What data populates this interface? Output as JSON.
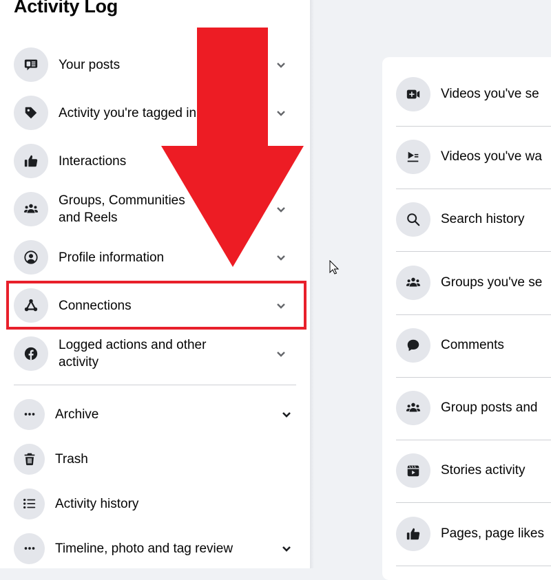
{
  "sidebar": {
    "title": "Activity Log",
    "items": [
      {
        "label": "Your posts",
        "icon": "post-icon",
        "expandable": true
      },
      {
        "label": "Activity you're tagged in",
        "icon": "tag-icon",
        "expandable": true
      },
      {
        "label": "Interactions",
        "icon": "thumbs-up-icon",
        "expandable": false
      },
      {
        "label": "Groups, Communities and Reels",
        "label_line1": "Groups, Communities",
        "label_line2": "and Reels",
        "icon": "groups-icon",
        "expandable": true
      },
      {
        "label": "Profile information",
        "icon": "profile-icon",
        "expandable": true
      },
      {
        "label": "Connections",
        "icon": "connections-icon",
        "expandable": true,
        "highlighted": true
      },
      {
        "label": "Logged actions and other activity",
        "label_line1": "Logged actions and other",
        "label_line2": "activity",
        "icon": "facebook-icon",
        "expandable": true
      }
    ],
    "lower_items": [
      {
        "label": "Archive",
        "icon": "more-icon",
        "expandable": true
      },
      {
        "label": "Trash",
        "icon": "trash-icon",
        "expandable": false
      },
      {
        "label": "Activity history",
        "icon": "list-icon",
        "expandable": false
      },
      {
        "label": "Timeline, photo and tag review",
        "icon": "more-icon",
        "expandable": true
      }
    ]
  },
  "main": {
    "items": [
      {
        "label": "Videos you've searched for",
        "visible_text": "Videos you've se",
        "icon": "video-add-icon"
      },
      {
        "label": "Videos you've watched",
        "visible_text": "Videos you've wa",
        "icon": "video-playlist-icon"
      },
      {
        "label": "Search history",
        "visible_text": "Search history",
        "icon": "search-icon"
      },
      {
        "label": "Groups you've searched for",
        "visible_text": "Groups you've se",
        "icon": "groups-icon"
      },
      {
        "label": "Comments",
        "visible_text": "Comments",
        "icon": "comment-icon"
      },
      {
        "label": "Group posts and comments",
        "visible_text": "Group posts and",
        "icon": "groups-icon"
      },
      {
        "label": "Stories activity",
        "visible_text": "Stories activity",
        "icon": "stories-icon"
      },
      {
        "label": "Pages, page likes",
        "visible_text": "Pages, page likes",
        "icon": "thumbs-up-icon"
      }
    ]
  },
  "annotation": {
    "arrow_color": "#ed1c24",
    "highlight_target": "Connections"
  },
  "colors": {
    "icon_bg": "#e4e6eb",
    "page_bg": "#f0f2f5",
    "text": "#050505",
    "chevron": "#65676b"
  }
}
